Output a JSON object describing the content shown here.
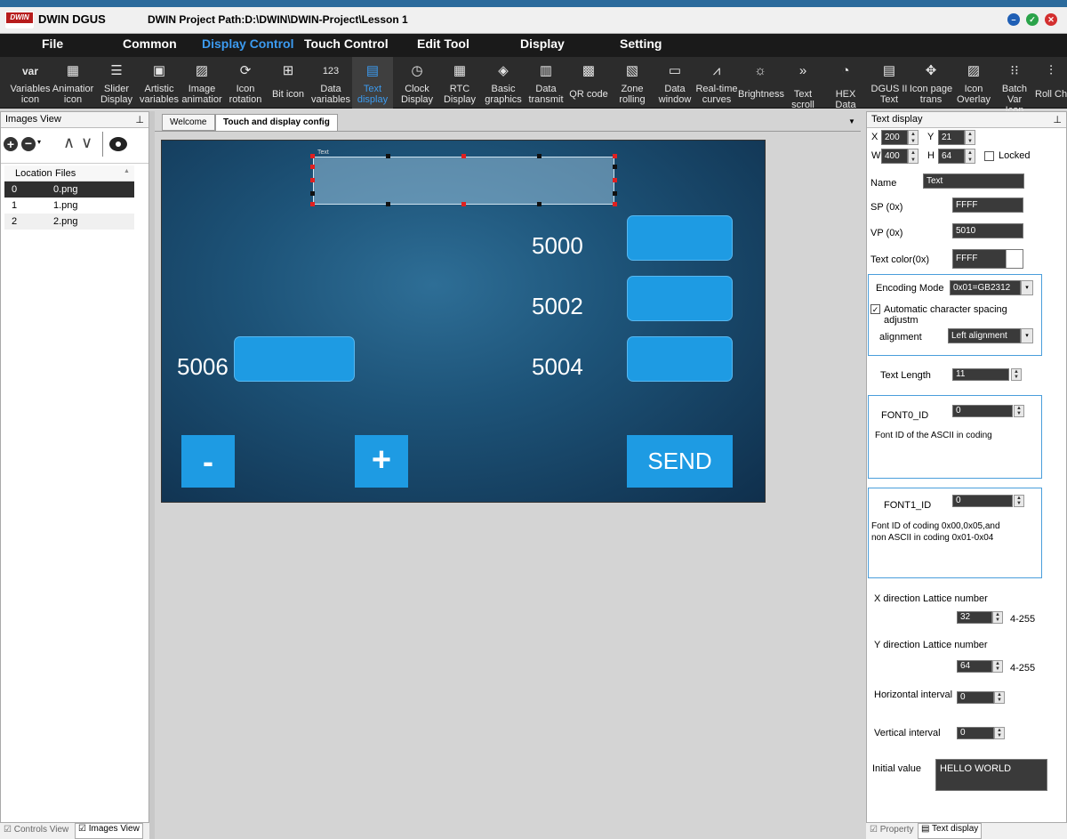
{
  "app": {
    "name": "DWIN DGUS",
    "project_path": "DWIN Project Path:D:\\DWIN\\DWIN-Project\\Lesson 1",
    "logo_text": "DWIN"
  },
  "menu": [
    "File",
    "Common",
    "Display Control",
    "Touch Control",
    "Edit Tool",
    "Display",
    "Setting"
  ],
  "menu_active": "Display Control",
  "toolbar": [
    {
      "l1": "Variables",
      "l2": "icon",
      "icon": "var-icon"
    },
    {
      "l1": "Animatior",
      "l2": "icon",
      "icon": "animation-icon"
    },
    {
      "l1": "Slider",
      "l2": "Display",
      "icon": "slider-icon"
    },
    {
      "l1": "Artistic",
      "l2": "variables",
      "icon": "artistic-icon"
    },
    {
      "l1": "Image",
      "l2": "animatior",
      "icon": "image-icon"
    },
    {
      "l1": "Icon",
      "l2": "rotation",
      "icon": "rotation-icon"
    },
    {
      "l1": "Bit icon",
      "l2": "",
      "icon": "bit-icon"
    },
    {
      "l1": "Data",
      "l2": "variables",
      "icon": "data-icon"
    },
    {
      "l1": "Text",
      "l2": "display",
      "icon": "text-icon"
    },
    {
      "l1": "Clock",
      "l2": "Display",
      "icon": "clock-icon"
    },
    {
      "l1": "RTC",
      "l2": "Display",
      "icon": "rtc-icon"
    },
    {
      "l1": "Basic",
      "l2": "graphics",
      "icon": "graphics-icon"
    },
    {
      "l1": "Data",
      "l2": "transmit",
      "icon": "transmit-icon"
    },
    {
      "l1": "QR code",
      "l2": "",
      "icon": "qr-icon"
    },
    {
      "l1": "Zone",
      "l2": "rolling",
      "icon": "zone-icon"
    },
    {
      "l1": "Data",
      "l2": "window",
      "icon": "window-icon"
    },
    {
      "l1": "Real-time",
      "l2": "curves",
      "icon": "curves-icon"
    },
    {
      "l1": "Brightness",
      "l2": "",
      "icon": "brightness-icon"
    },
    {
      "l1": "Text scroll",
      "l2": "",
      "icon": "scroll-icon"
    },
    {
      "l1": "HEX Data",
      "l2": "",
      "icon": "hex-icon"
    },
    {
      "l1": "DGUS II",
      "l2": "Text",
      "icon": "dgus-text-icon"
    },
    {
      "l1": "Icon page",
      "l2": "trans",
      "icon": "page-trans-icon"
    },
    {
      "l1": "Icon",
      "l2": "Overlay",
      "icon": "overlay-icon"
    },
    {
      "l1": "Batch Var",
      "l2": "Icon",
      "icon": "batch-icon"
    },
    {
      "l1": "Roll Ch",
      "l2": "",
      "icon": "roll-icon"
    }
  ],
  "left_panel": {
    "title": "Images View",
    "columns": [
      "Location",
      "Files"
    ],
    "rows": [
      [
        "0",
        "0.png"
      ],
      [
        "1",
        "1.png"
      ],
      [
        "2",
        "2.png"
      ]
    ],
    "tabs": [
      "Controls View",
      "Images View"
    ]
  },
  "doc_tabs": [
    "Welcome",
    "Touch and display config"
  ],
  "canvas": {
    "control_label": "Text",
    "labels": [
      "5000",
      "5002",
      "5004",
      "5006"
    ],
    "buttons": [
      "-",
      "+",
      "SEND"
    ]
  },
  "right_panel": {
    "title": "Text display",
    "x_label": "X",
    "x": "200",
    "y_label": "Y",
    "y": "21",
    "w_label": "W",
    "w": "400",
    "h_label": "H",
    "h": "64",
    "locked": "Locked",
    "name_label": "Name",
    "name": "Text",
    "sp_label": "SP (0x)",
    "sp": "FFFF",
    "vp_label": "VP (0x)",
    "vp": "5010",
    "color_label": "Text color(0x)",
    "color": "FFFF",
    "encoding_label": "Encoding Mode",
    "encoding": "0x01=GB2312",
    "auto_spacing": "Automatic character spacing adjustm",
    "alignment_label": "alignment",
    "alignment": "Left alignment",
    "text_length_label": "Text Length",
    "text_length": "11",
    "font0_label": "FONT0_ID",
    "font0": "0",
    "font0_desc": "Font ID of the ASCII in coding",
    "font1_label": "FONT1_ID",
    "font1": "0",
    "font1_desc1": "Font ID of coding 0x00,0x05,and",
    "font1_desc2": "non ASCII in coding 0x01-0x04",
    "xlat_label": "X direction Lattice number",
    "xlat": "32",
    "xlat_range": "4-255",
    "ylat_label": "Y direction Lattice number",
    "ylat": "64",
    "ylat_range": "4-255",
    "hint_label": "Horizontal interval",
    "hint": "0",
    "vint_label": "Vertical interval",
    "vint": "0",
    "init_label": "Initial value",
    "init": "HELLO WORLD",
    "tabs": [
      "Property",
      "Text display"
    ]
  }
}
